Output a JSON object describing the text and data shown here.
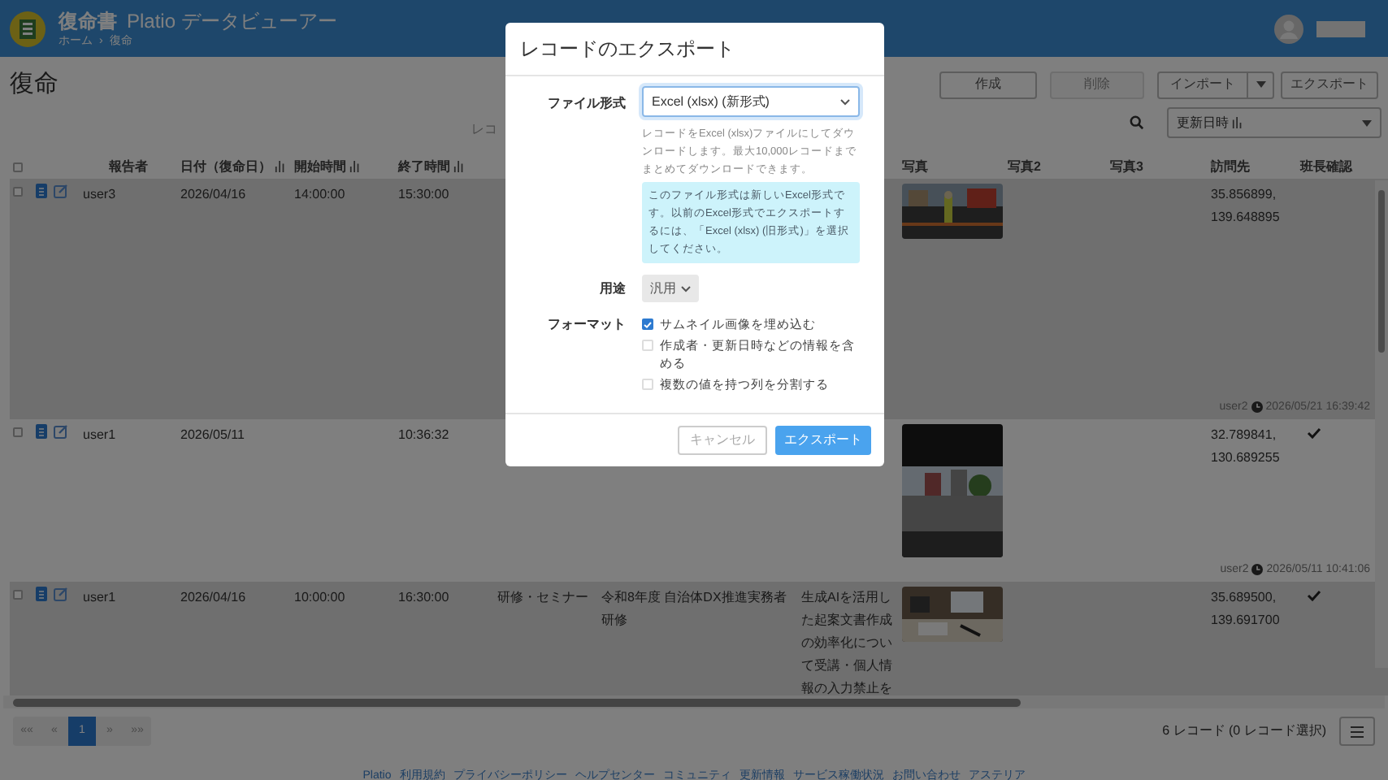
{
  "app_header": {
    "title": "復命書",
    "subtitle": "Platio データビューアー",
    "breadcrumb": [
      "ホーム",
      "復命"
    ],
    "breadcrumb_separator": "›"
  },
  "page_title": "復命",
  "toolbar": {
    "buttons": [
      {
        "label": "作成",
        "disabled": false
      },
      {
        "label": "削除",
        "disabled": true
      }
    ],
    "import_button": "インポート",
    "export_button": "エクスポート"
  },
  "search": {
    "placeholder": "レコ"
  },
  "sort": {
    "value": "更新日時"
  },
  "table": {
    "select_all_checked": false,
    "columns": [
      {
        "label": "報告者",
        "sortable": false
      },
      {
        "label": "日付（復命日）",
        "sortable": true
      },
      {
        "label": "開始時間",
        "sortable": true
      },
      {
        "label": "終了時間",
        "sortable": true
      },
      {
        "label": "写真",
        "sortable": false
      },
      {
        "label": "写真2",
        "sortable": false
      },
      {
        "label": "写真3",
        "sortable": false
      },
      {
        "label": "訪問先",
        "sortable": false
      },
      {
        "label": "班長確認",
        "sortable": false
      }
    ],
    "rows": [
      {
        "checked": false,
        "reporter": "user3",
        "date": "2026/04/16",
        "start_time": "14:00:00",
        "end_time": "15:30:00",
        "location": "35.856899,\n139.648895",
        "confirmed": false,
        "updated_by": "user2",
        "updated_at": "2026/05/21 16:39:42"
      },
      {
        "checked": false,
        "reporter": "user1",
        "date": "2026/05/11",
        "end_time": "10:36:32",
        "location": "32.789841,\n130.689255",
        "confirmed": true,
        "updated_by": "user2",
        "updated_at": "2026/05/11 10:41:06"
      },
      {
        "checked": false,
        "reporter": "user1",
        "date": "2026/04/16",
        "start_time": "10:00:00",
        "end_time": "16:30:00",
        "column_5": "研修・セミナー",
        "column_6": "令和8年度 自治体DX推進実務者研修",
        "column_7": "生成AIを活用した起案文書作成の効率化について受講・個人情報の入力禁止を",
        "location": "35.689500,\n139.691700",
        "confirmed": true
      }
    ]
  },
  "pagination": {
    "first": "««",
    "prev": "«",
    "pages": [
      {
        "label": "1",
        "selected": true
      }
    ],
    "next": "»",
    "last": "»»"
  },
  "record_count": "6 レコード (0 レコード選択)",
  "footer_links": [
    "Platio",
    "利用規約",
    "プライバシーポリシー",
    "ヘルプセンター",
    "コミュニティ",
    "更新情報",
    "サービス稼働状況",
    "お問い合わせ",
    "アステリア"
  ],
  "dialog": {
    "title": "レコードのエクスポート",
    "file_format": {
      "label": "ファイル形式",
      "value": "Excel (xlsx) (新形式)",
      "help": "レコードをExcel (xlsx)ファイルにしてダウンロードします。最大10,000レコードまでまとめてダウンロードできます。",
      "note": "このファイル形式は新しいExcel形式です。以前のExcel形式でエクスポートするには、「Excel (xlsx) (旧形式)」を選択してください。"
    },
    "purpose": {
      "label": "用途",
      "value": "汎用"
    },
    "format": {
      "label": "フォーマット",
      "options": [
        {
          "label": "サムネイル画像を埋め込む",
          "checked": true
        },
        {
          "label": "作成者・更新日時などの情報を含める",
          "checked": false
        },
        {
          "label": "複数の値を持つ列を分割する",
          "checked": false
        }
      ]
    },
    "cancel_button": "キャンセル",
    "export_button": "エクスポート"
  }
}
